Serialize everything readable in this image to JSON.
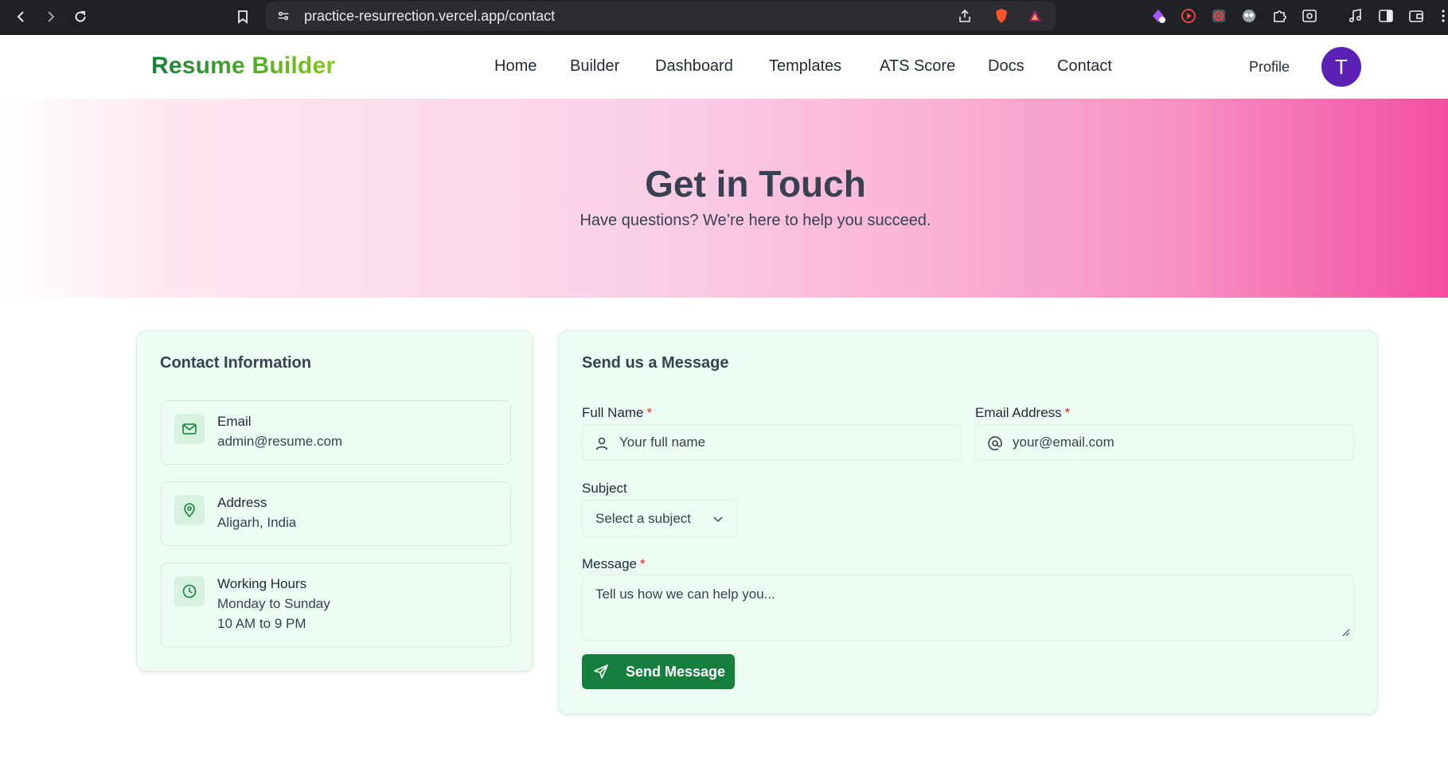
{
  "browser": {
    "url": "practice-resurrection.vercel.app/contact"
  },
  "header": {
    "logo": "Resume Builder",
    "nav": [
      "Home",
      "Builder",
      "Dashboard",
      "Templates",
      "ATS Score",
      "Docs",
      "Contact"
    ],
    "profile_label": "Profile",
    "avatar_initial": "T"
  },
  "hero": {
    "title": "Get in Touch",
    "subtitle": "Have questions? We’re here to help you succeed."
  },
  "contact_info": {
    "title": "Contact Information",
    "items": [
      {
        "label": "Email",
        "lines": [
          "admin@resume.com"
        ],
        "icon": "mail-icon"
      },
      {
        "label": "Address",
        "lines": [
          "Aligarh, India"
        ],
        "icon": "map-pin-icon"
      },
      {
        "label": "Working Hours",
        "lines": [
          "Monday to Sunday",
          "10 AM to 9 PM"
        ],
        "icon": "clock-icon"
      }
    ]
  },
  "form": {
    "title": "Send us a Message",
    "full_name": {
      "label": "Full Name",
      "required": "*",
      "placeholder": "Your full name"
    },
    "email": {
      "label": "Email Address",
      "required": "*",
      "placeholder": "your@email.com"
    },
    "subject": {
      "label": "Subject",
      "selected": "Select a subject"
    },
    "message": {
      "label": "Message",
      "required": "*",
      "placeholder": "Tell us how we can help you..."
    },
    "submit_label": "Send Message"
  },
  "colors": {
    "brand_green": "#15803d",
    "avatar_purple": "#5b21b6",
    "card_bg": "#effcf3",
    "required_red": "#dc2626"
  }
}
